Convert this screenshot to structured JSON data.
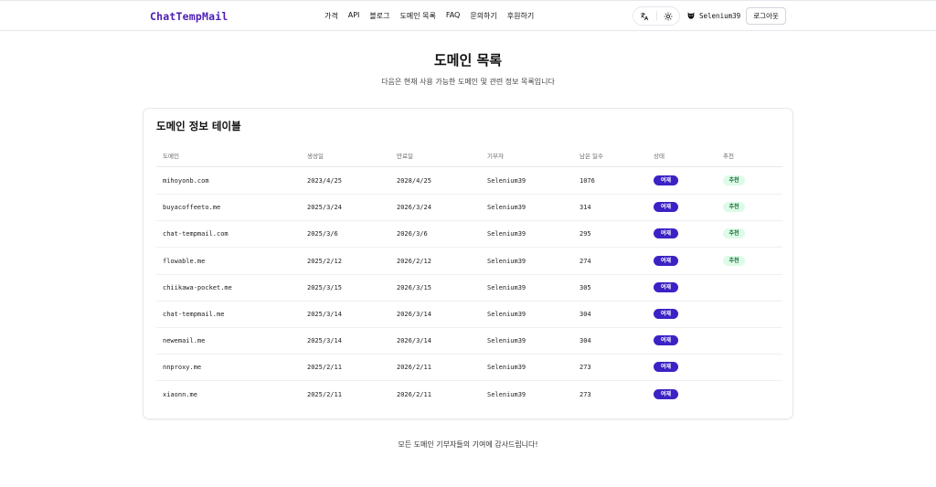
{
  "header": {
    "logo": "ChatTempMail",
    "nav": [
      "가격",
      "API",
      "블로그",
      "도메인 목록",
      "FAQ",
      "문의하기",
      "후원하기"
    ],
    "username": "Selenium39",
    "logout_label": "로그아웃",
    "translate_icon": "translate-icon",
    "theme_icon": "sun-icon",
    "avatar_icon": "github-cat-icon"
  },
  "main": {
    "title": "도메인 목록",
    "subtitle": "다음은 현재 사용 가능한 도메인 및 관련 정보 목록입니다"
  },
  "table": {
    "title": "도메인 정보 테이블",
    "columns": [
      "도메인",
      "생성일",
      "만료일",
      "기부자",
      "남은 일수",
      "상태",
      "추천"
    ],
    "rows": [
      {
        "domain": "mihoyonb.com",
        "created": "2023/4/25",
        "expires": "2028/4/25",
        "donor": "Selenium39",
        "days_left": "1076",
        "status": "여재",
        "recommended": "추천"
      },
      {
        "domain": "buyacoffeeto.me",
        "created": "2025/3/24",
        "expires": "2026/3/24",
        "donor": "Selenium39",
        "days_left": "314",
        "status": "여재",
        "recommended": "추천"
      },
      {
        "domain": "chat-tempmail.com",
        "created": "2025/3/6",
        "expires": "2026/3/6",
        "donor": "Selenium39",
        "days_left": "295",
        "status": "여재",
        "recommended": "추천"
      },
      {
        "domain": "flowable.me",
        "created": "2025/2/12",
        "expires": "2026/2/12",
        "donor": "Selenium39",
        "days_left": "274",
        "status": "여재",
        "recommended": "추천"
      },
      {
        "domain": "chiikawa-pocket.me",
        "created": "2025/3/15",
        "expires": "2026/3/15",
        "donor": "Selenium39",
        "days_left": "305",
        "status": "여재",
        "recommended": ""
      },
      {
        "domain": "chat-tempmail.me",
        "created": "2025/3/14",
        "expires": "2026/3/14",
        "donor": "Selenium39",
        "days_left": "304",
        "status": "여재",
        "recommended": ""
      },
      {
        "domain": "newemail.me",
        "created": "2025/3/14",
        "expires": "2026/3/14",
        "donor": "Selenium39",
        "days_left": "304",
        "status": "여재",
        "recommended": ""
      },
      {
        "domain": "nnproxy.me",
        "created": "2025/2/11",
        "expires": "2026/2/11",
        "donor": "Selenium39",
        "days_left": "273",
        "status": "여재",
        "recommended": ""
      },
      {
        "domain": "xiaonn.me",
        "created": "2025/2/11",
        "expires": "2026/2/11",
        "donor": "Selenium39",
        "days_left": "273",
        "status": "여재",
        "recommended": ""
      }
    ]
  },
  "footer": {
    "note": "모든 도메인 기부자들의 기여에 감사드립니다!"
  },
  "colors": {
    "brand": "#4c1db8",
    "status_badge": "#3b22c5",
    "recommend_bg": "#dcfce7",
    "recommend_text": "#166534"
  }
}
